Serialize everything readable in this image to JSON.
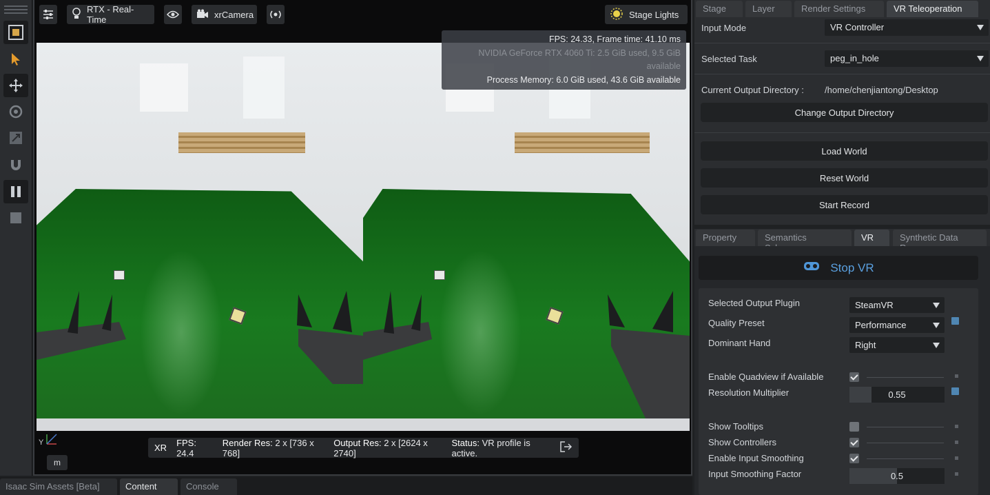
{
  "viewport": {
    "toolbar": {
      "render_mode": "RTX - Real-Time",
      "camera": "xrCamera",
      "lights": "Stage Lights"
    },
    "stats": {
      "fps_line": "FPS: 24.33, Frame time: 41.10 ms",
      "gpu_line": "NVIDIA GeForce RTX 4060 Ti: 2.5 GiB used, 9.5 GiB available",
      "mem_line": "Process Memory: 6.0 GiB used, 43.6 GiB available",
      "resolution": "949x681"
    },
    "xr_bar": {
      "title": "XR",
      "fps_label": "FPS:",
      "fps": "24.4",
      "render_label": "Render Res:",
      "render": "2 x [736 x 768]",
      "output_label": "Output Res:",
      "output": "2 x [2624 x 2740]",
      "status_label": "Status:",
      "status": "VR profile is active."
    },
    "axis_label": "Y",
    "units": "m"
  },
  "bottom_tabs": [
    "Isaac Sim Assets [Beta]",
    "Content",
    "Console"
  ],
  "right": {
    "top_tabs": [
      "Stage",
      "Layer",
      "Render Settings",
      "VR Teleoperation"
    ],
    "input_mode_label": "Input Mode",
    "input_mode": "VR Controller",
    "task_label": "Selected Task",
    "task": "peg_in_hole",
    "outdir_label": "Current Output Directory :",
    "outdir": "/home/chenjiantong/Desktop",
    "change_dir": "Change Output Directory",
    "load": "Load World",
    "reset": "Reset World",
    "record": "Start Record",
    "mid_tabs": [
      "Property",
      "Semantics Schema...",
      "VR",
      "Synthetic Data Rec..."
    ],
    "stop_vr": "Stop VR",
    "plugin_label": "Selected Output Plugin",
    "plugin": "SteamVR",
    "quality_label": "Quality Preset",
    "quality": "Performance",
    "hand_label": "Dominant Hand",
    "hand": "Right",
    "quadview_label": "Enable Quadview if Available",
    "resmul_label": "Resolution Multiplier",
    "resmul": "0.55",
    "tooltips_label": "Show Tooltips",
    "controllers_label": "Show Controllers",
    "smoothing_label": "Enable Input Smoothing",
    "smooth_factor_label": "Input Smoothing Factor",
    "smooth_factor": "0.5"
  }
}
